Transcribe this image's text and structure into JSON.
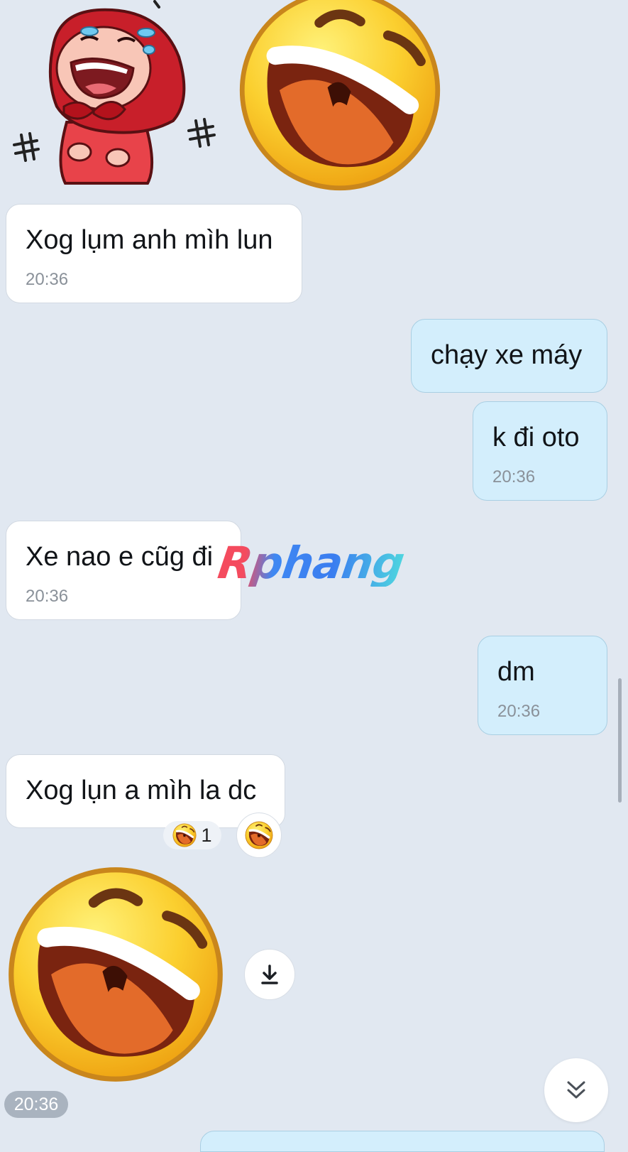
{
  "messages": [
    {
      "direction": "incoming",
      "text": "Xog lụm anh mìh lun",
      "time": "20:36"
    },
    {
      "direction": "outgoing",
      "text": "chạy xe máy"
    },
    {
      "direction": "outgoing",
      "text": "k đi oto",
      "time": "20:36"
    },
    {
      "direction": "incoming",
      "text": "Xe nao e cũg đi",
      "time": "20:36"
    },
    {
      "direction": "outgoing",
      "text": "dm",
      "time": "20:36"
    },
    {
      "direction": "incoming",
      "text": "Xog lụn a mìh la dc"
    }
  ],
  "reaction": {
    "emoji": "laughing-face",
    "count": "1"
  },
  "sticker_time": "20:36",
  "watermark": "Rphang",
  "colors": {
    "background": "#e1e8f1",
    "incoming_bubble": "#ffffff",
    "outgoing_bubble": "#d3eefc",
    "outgoing_border": "#a9cfe3"
  },
  "icons": [
    "laughing-face-sticker",
    "crying-laughing-girl-sticker",
    "download-icon",
    "double-chevron-down-icon"
  ]
}
